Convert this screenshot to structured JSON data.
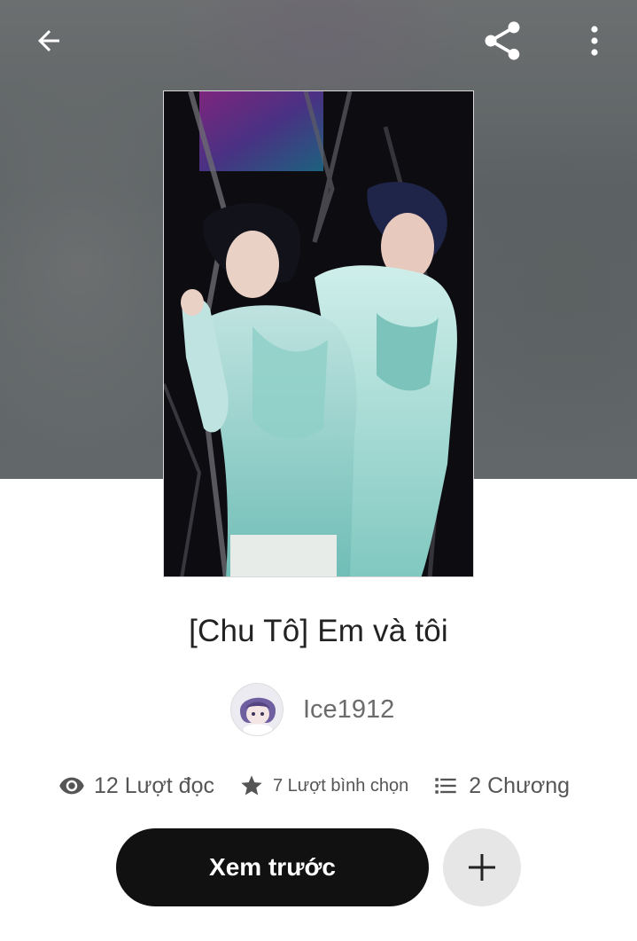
{
  "header": {
    "back_icon": "arrow-left-icon",
    "share_icon": "share-icon",
    "more_icon": "more-vertical-icon"
  },
  "story": {
    "title": "[Chu Tô] Em và tôi",
    "author": "Ice1912"
  },
  "stats": {
    "reads": "12 Lượt đọc",
    "votes": "7 Lượt bình chọn",
    "parts": "2 Chương"
  },
  "actions": {
    "preview_label": "Xem trước",
    "add_icon": "plus-icon"
  },
  "colors": {
    "primary_button": "#111111",
    "secondary_button": "#e6e6e6",
    "text_primary": "#222222",
    "text_secondary": "#555555"
  }
}
